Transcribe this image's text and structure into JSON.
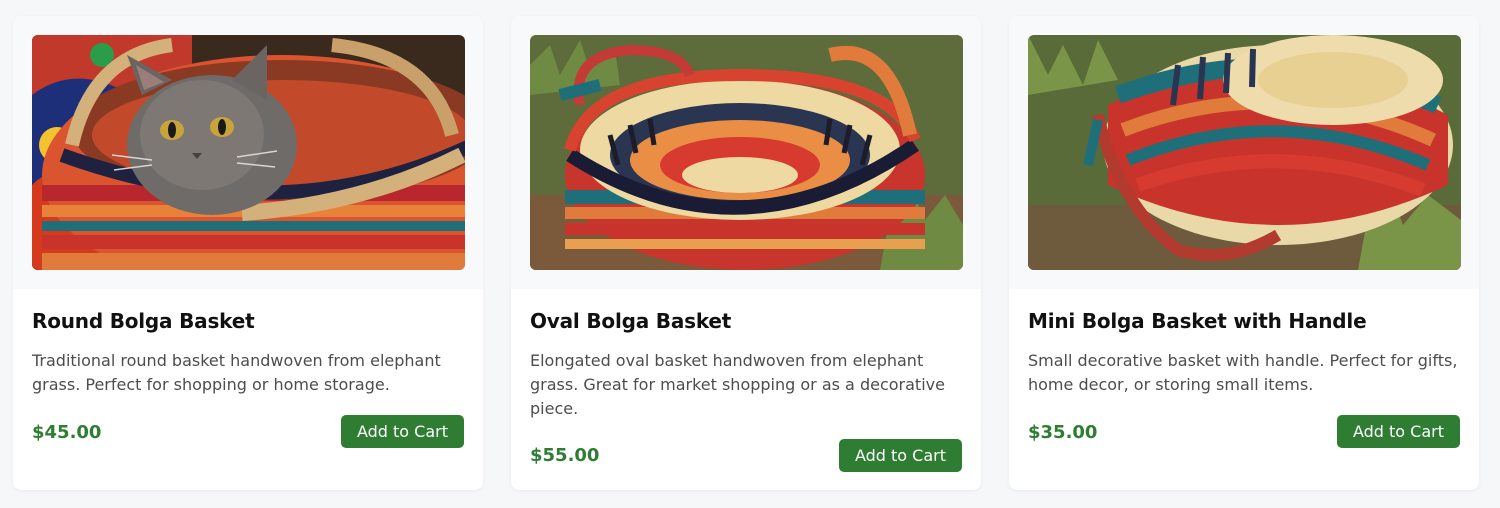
{
  "colors": {
    "price": "#2e7d32",
    "button_bg": "#2e7d32",
    "button_text": "#ffffff",
    "page_bg": "#f6f7f9"
  },
  "products": [
    {
      "image": "round-basket-with-cat-photo",
      "name": "Round Bolga Basket",
      "description": "Traditional round basket handwoven from elephant grass. Perfect for shopping or home storage.",
      "price": "$45.00",
      "button_label": "Add to Cart"
    },
    {
      "image": "oval-basket-on-grass-photo",
      "name": "Oval Bolga Basket",
      "description": "Elongated oval basket handwoven from elephant grass. Great for market shopping or as a decorative piece.",
      "price": "$55.00",
      "button_label": "Add to Cart"
    },
    {
      "image": "mini-basket-upside-down-photo",
      "name": "Mini Bolga Basket with Handle",
      "description": "Small decorative basket with handle. Perfect for gifts, home decor, or storing small items.",
      "price": "$35.00",
      "button_label": "Add to Cart"
    }
  ]
}
